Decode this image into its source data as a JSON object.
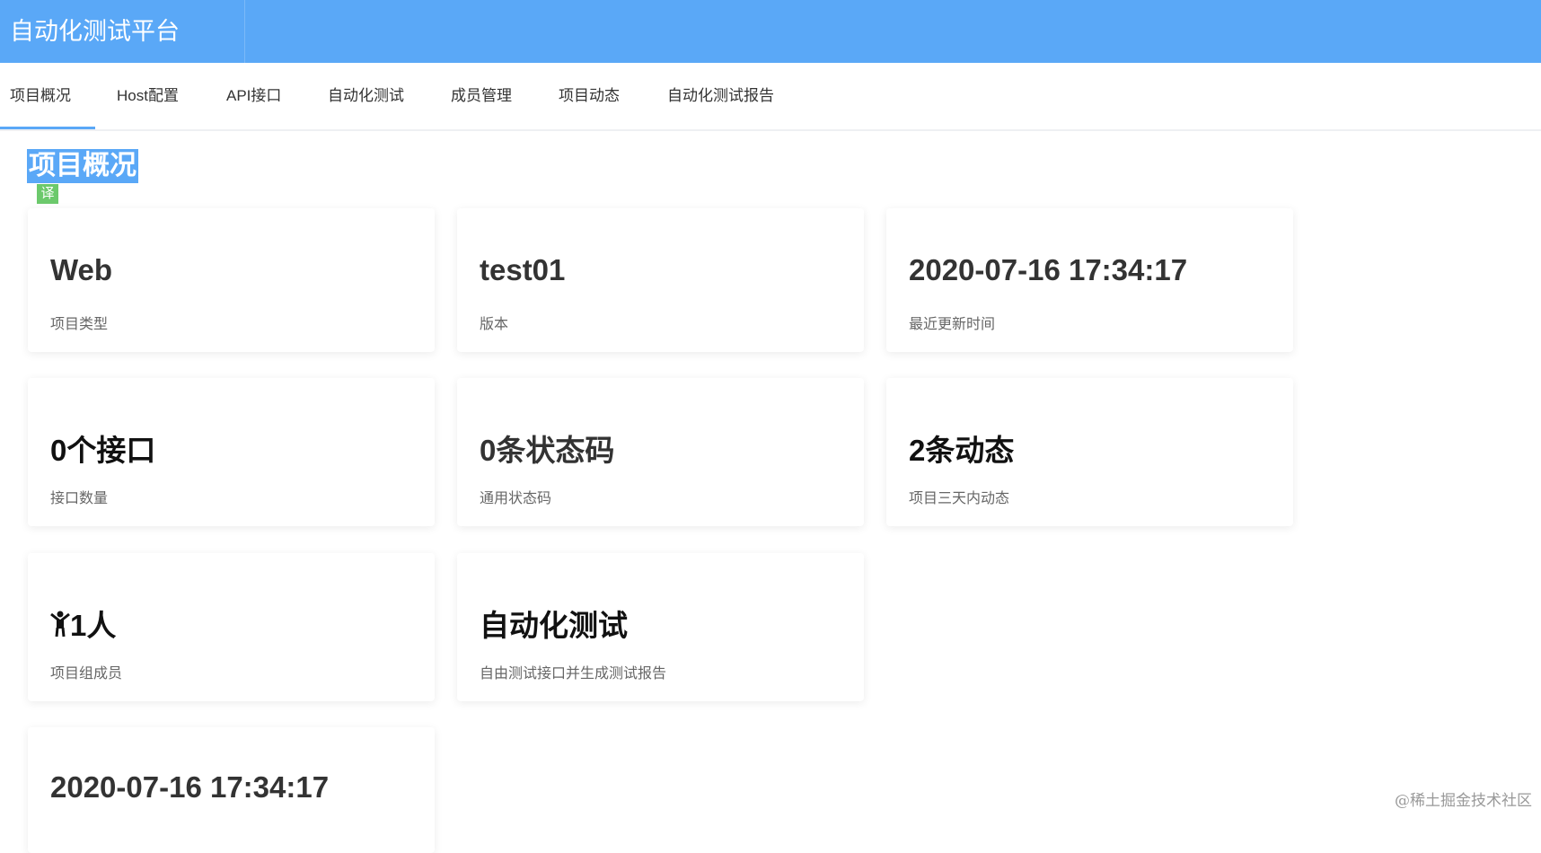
{
  "header": {
    "title": "自动化测试平台"
  },
  "nav": {
    "tabs": [
      {
        "label": "项目概况"
      },
      {
        "label": "Host配置"
      },
      {
        "label": "API接口"
      },
      {
        "label": "自动化测试"
      },
      {
        "label": "成员管理"
      },
      {
        "label": "项目动态"
      },
      {
        "label": "自动化测试报告"
      }
    ],
    "active": 0
  },
  "page": {
    "heading": "项目概况",
    "translate_badge": "译"
  },
  "cards": [
    {
      "value": "Web",
      "label": "项目类型"
    },
    {
      "value": "test01",
      "label": "版本"
    },
    {
      "value": "2020-07-16 17:34:17",
      "label": "最近更新时间"
    },
    {
      "value": "0个接口",
      "label": "接口数量"
    },
    {
      "value": "0条状态码",
      "label": "通用状态码"
    },
    {
      "value": "2条动态",
      "label": "项目三天内动态"
    },
    {
      "value": "1人",
      "label": "项目组成员",
      "icon": "person-icon"
    },
    {
      "value": "自动化测试",
      "label": "自由测试接口并生成测试报告"
    },
    {
      "value": "2020-07-16 17:34:17"
    }
  ],
  "watermark": "@稀土掘金技术社区"
}
